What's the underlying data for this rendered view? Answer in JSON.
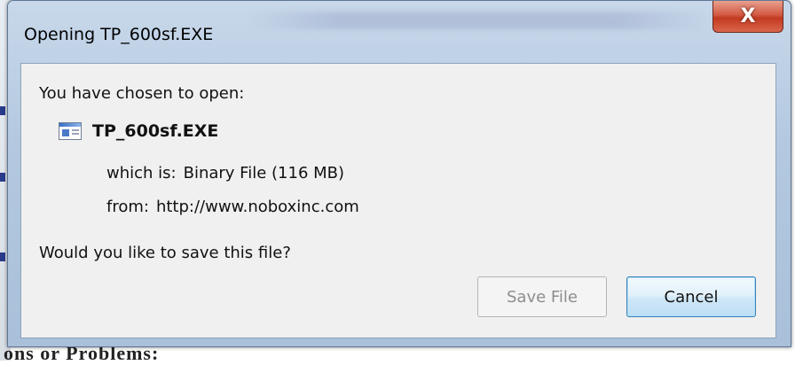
{
  "background": {
    "bottom_text": "ons or Problems:"
  },
  "window": {
    "title": "Opening TP_600sf.EXE",
    "close_glyph": "X"
  },
  "dialog": {
    "prompt": "You have chosen to open:",
    "file_name": "TP_600sf.EXE",
    "which_is_label": "which is:",
    "which_is_value": "Binary File (116 MB)",
    "from_label": "from:",
    "from_value": "http://www.noboxinc.com",
    "question": "Would you like to save this file?",
    "buttons": {
      "save_label": "Save File",
      "cancel_label": "Cancel"
    }
  },
  "icons": {
    "file": "executable-file-icon",
    "close": "close-icon"
  },
  "colors": {
    "close_red": "#c23a22",
    "default_button_border": "#3c7fb1"
  }
}
